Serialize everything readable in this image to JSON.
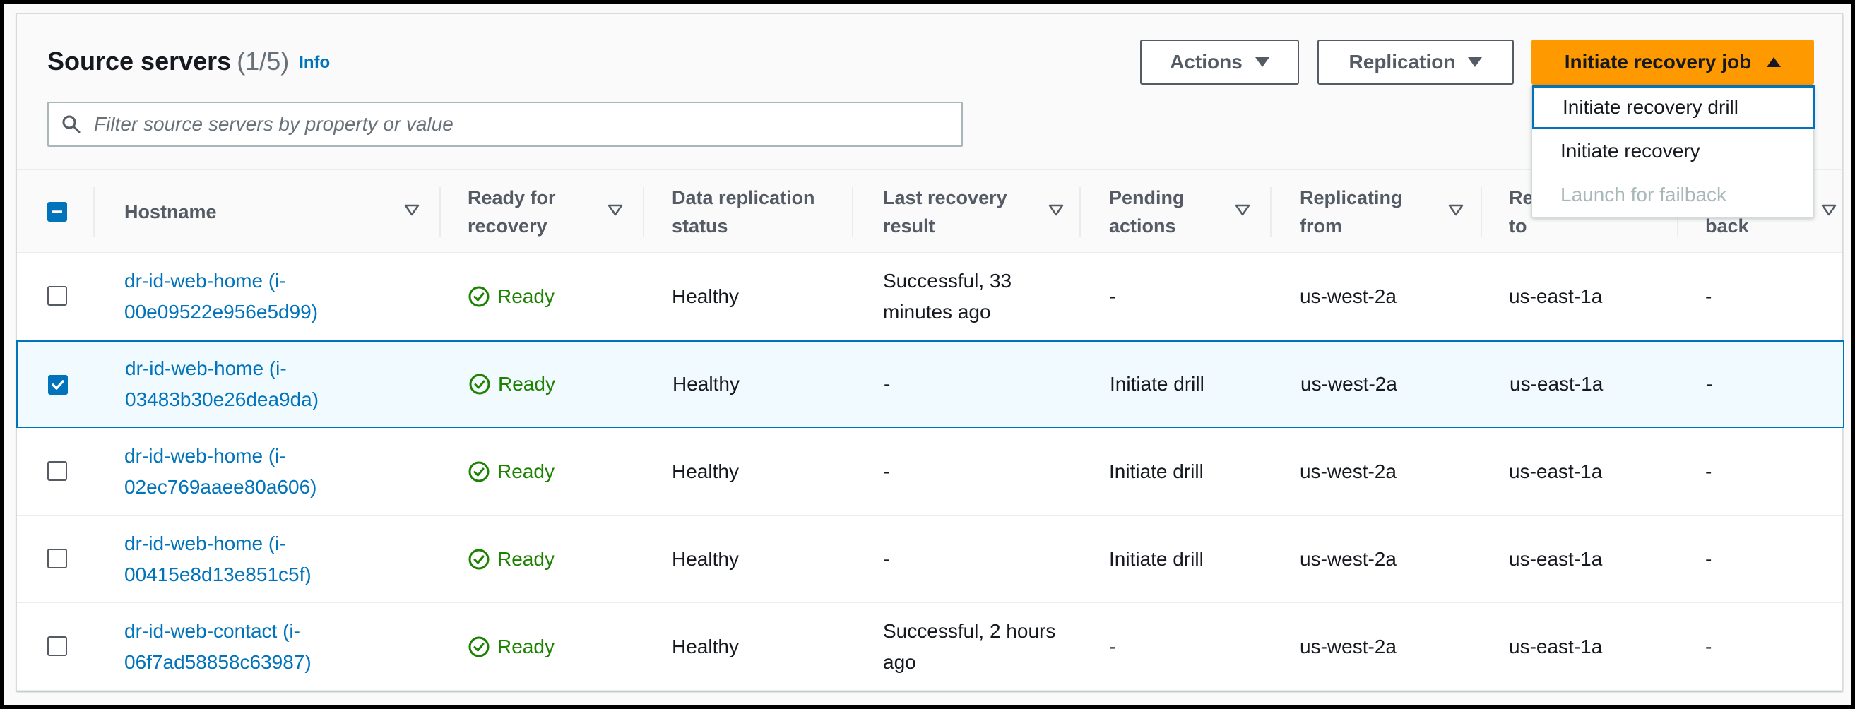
{
  "header": {
    "title": "Source servers",
    "count": "(1/5)",
    "info_link": "Info"
  },
  "buttons": {
    "actions": "Actions",
    "replication": "Replication",
    "initiate": "Initiate recovery job"
  },
  "dropdown": {
    "items": [
      {
        "label": "Initiate recovery drill",
        "state": "focused"
      },
      {
        "label": "Initiate recovery",
        "state": "normal"
      },
      {
        "label": "Launch for failback",
        "state": "disabled"
      }
    ]
  },
  "search": {
    "placeholder": "Filter source servers by property or value"
  },
  "table": {
    "columns": [
      {
        "line1": "Hostname",
        "line2": ""
      },
      {
        "line1": "Ready for",
        "line2": "recovery"
      },
      {
        "line1": "Data replication",
        "line2": "status"
      },
      {
        "line1": "Last recovery",
        "line2": "result"
      },
      {
        "line1": "Pending",
        "line2": "actions"
      },
      {
        "line1": "Replicating",
        "line2": "from"
      },
      {
        "line1": "Re",
        "line2": "to"
      },
      {
        "line1": "",
        "line2": "back"
      }
    ],
    "rows": [
      {
        "selected": false,
        "hostname_1": "dr-id-web-home (i-",
        "hostname_2": "00e09522e956e5d99)",
        "ready": "Ready",
        "replication": "Healthy",
        "last_1": "Successful, 33",
        "last_2": "minutes ago",
        "pending": "-",
        "from": "us-west-2a",
        "to": "us-east-1a",
        "back": "-"
      },
      {
        "selected": true,
        "hostname_1": "dr-id-web-home (i-",
        "hostname_2": "03483b30e26dea9da)",
        "ready": "Ready",
        "replication": "Healthy",
        "last_1": "-",
        "last_2": "",
        "pending": "Initiate drill",
        "from": "us-west-2a",
        "to": "us-east-1a",
        "back": "-"
      },
      {
        "selected": false,
        "hostname_1": "dr-id-web-home (i-",
        "hostname_2": "02ec769aaee80a606)",
        "ready": "Ready",
        "replication": "Healthy",
        "last_1": "-",
        "last_2": "",
        "pending": "Initiate drill",
        "from": "us-west-2a",
        "to": "us-east-1a",
        "back": "-"
      },
      {
        "selected": false,
        "hostname_1": "dr-id-web-home (i-",
        "hostname_2": "00415e8d13e851c5f)",
        "ready": "Ready",
        "replication": "Healthy",
        "last_1": "-",
        "last_2": "",
        "pending": "Initiate drill",
        "from": "us-west-2a",
        "to": "us-east-1a",
        "back": "-"
      },
      {
        "selected": false,
        "hostname_1": "dr-id-web-contact (i-",
        "hostname_2": "06f7ad58858c63987)",
        "ready": "Ready",
        "replication": "Healthy",
        "last_1": "Successful, 2 hours",
        "last_2": "ago",
        "pending": "-",
        "from": "us-west-2a",
        "to": "us-east-1a",
        "back": "-"
      }
    ]
  },
  "colors": {
    "primary": "#ff9900",
    "link": "#0073bb",
    "success": "#1d8102"
  }
}
